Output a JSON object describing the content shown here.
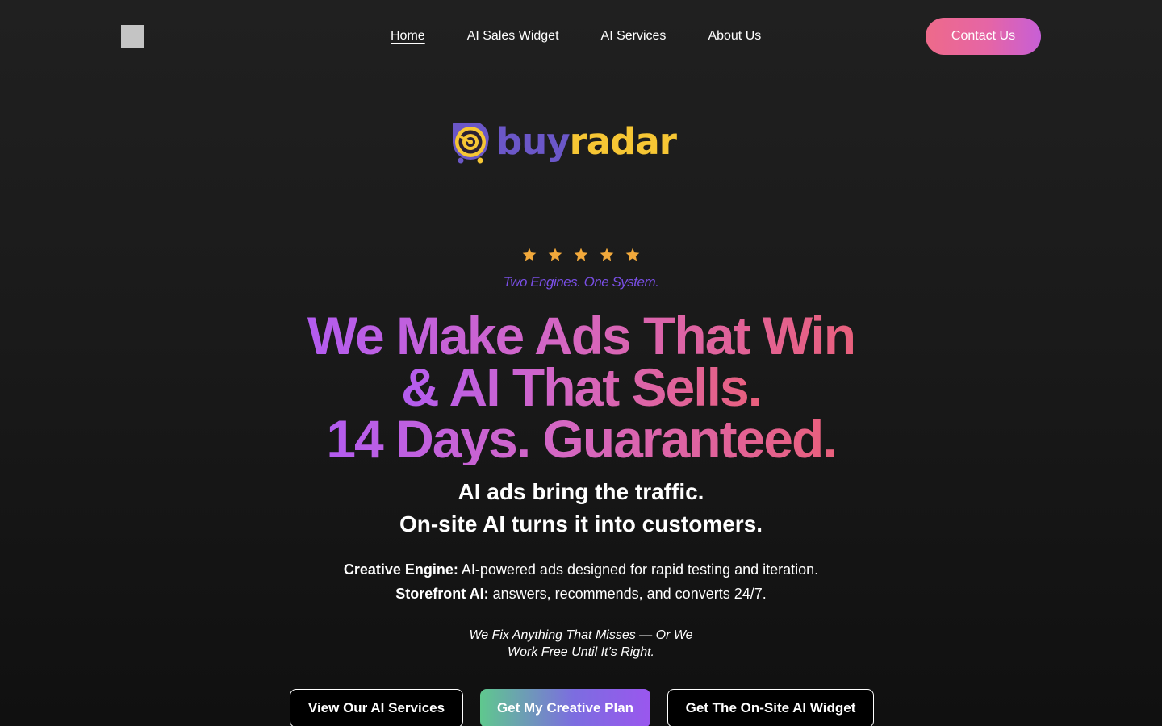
{
  "nav": {
    "items": [
      {
        "label": "Home",
        "active": true
      },
      {
        "label": "AI Sales Widget"
      },
      {
        "label": "AI Services"
      },
      {
        "label": "About Us"
      }
    ],
    "contact_label": "Contact Us"
  },
  "brand": {
    "icon": "radar-icon",
    "word_buy": "buy",
    "word_radar": "radar",
    "colors": {
      "buy": "#6b57c8",
      "radar": "#f6c634"
    }
  },
  "hero": {
    "rating": 5,
    "tagline": "Two Engines. One System.",
    "headline": [
      "We Make Ads That Win",
      "& AI That Sells.",
      "14 Days. Guaranteed."
    ],
    "subheadline": [
      "AI ads bring the traffic.",
      "On-site AI turns it into customers."
    ],
    "features": [
      {
        "label": "Creative Engine:",
        "text": " AI-powered ads designed for rapid testing and iteration."
      },
      {
        "label": "Storefront AI:",
        "text": " answers, recommends, and converts 24/7."
      }
    ],
    "guarantee": [
      "We Fix Anything That Misses — Or We",
      "Work Free Until It’s Right."
    ]
  },
  "cta": {
    "services": "View Our AI Services",
    "creative_plan": "Get My Creative Plan",
    "widget": "Get The On-Site AI Widget"
  },
  "colors": {
    "background": "#1c1c1c",
    "accent_pink": "#ee6a8a",
    "accent_purple": "#b35cf0",
    "star": "#f2a93b",
    "tagline": "#7a4fe6"
  }
}
